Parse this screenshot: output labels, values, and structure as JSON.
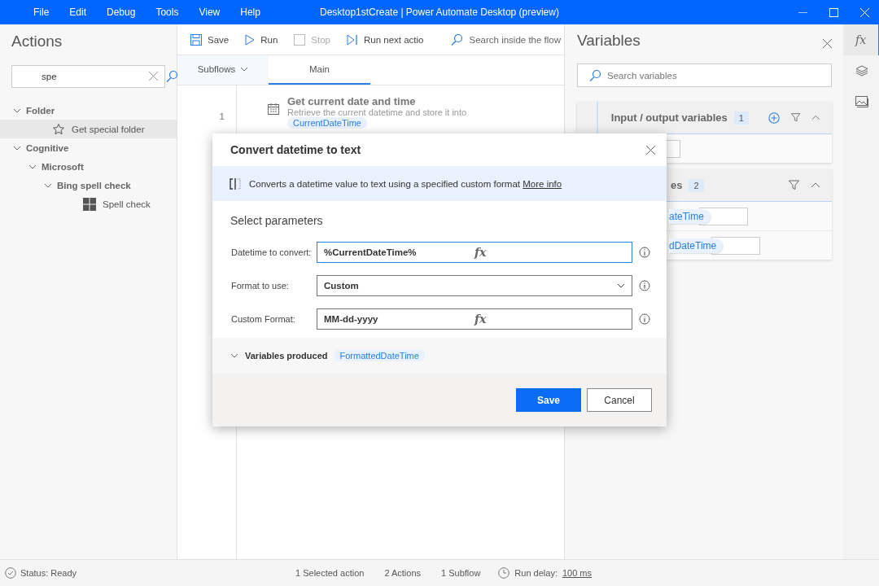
{
  "window": {
    "menu": [
      "File",
      "Edit",
      "Debug",
      "Tools",
      "View",
      "Help"
    ],
    "title": "Desktop1stCreate | Power Automate Desktop (preview)"
  },
  "actions": {
    "title": "Actions",
    "search": {
      "value": "spe"
    },
    "tree": [
      {
        "label": "Folder",
        "expanded": true,
        "children": [
          {
            "label": "Get special folder",
            "selected": true
          }
        ]
      },
      {
        "label": "Cognitive",
        "expanded": true,
        "children": [
          {
            "label": "Microsoft",
            "expanded": true,
            "children": [
              {
                "label": "Bing spell check",
                "expanded": true,
                "children": [
                  {
                    "label": "Spell check",
                    "selected": false
                  }
                ]
              }
            ]
          }
        ]
      }
    ]
  },
  "toolbar": {
    "buttons": [
      {
        "label": "Save",
        "disabled": false
      },
      {
        "label": "Run",
        "disabled": false
      },
      {
        "label": "Stop",
        "disabled": true
      },
      {
        "label": "Run next actio",
        "disabled": false
      }
    ],
    "search": {
      "placeholder": "Search inside the flow"
    }
  },
  "tabs": [
    {
      "label": "Subflows",
      "kind": "dropdown",
      "selected": false
    },
    {
      "label": "Main",
      "kind": "tab",
      "selected": true
    }
  ],
  "steps": [
    {
      "number": "1",
      "title": "Get current date and time",
      "description": "Retrieve the current datetime and store it into",
      "variable": "CurrentDateTime"
    }
  ],
  "variables": {
    "title": "Variables",
    "search": {
      "placeholder": "Search variables"
    },
    "sections": [
      {
        "title": "Input / output variables",
        "count": "1",
        "expanded": true,
        "rows": [
          ""
        ]
      },
      {
        "title": "es",
        "count": "2",
        "expanded": true,
        "rows": [
          "ateTime",
          "dDateTime"
        ]
      }
    ]
  },
  "dialog": {
    "title": "Convert datetime to text",
    "info": "Converts a datetime value to text using a specified custom format",
    "link": "More info",
    "heading": "Select parameters",
    "params": [
      {
        "label": "Datetime to convert:",
        "value": "%CurrentDateTime%",
        "kind": "expression",
        "focused": true,
        "button": "fx"
      },
      {
        "label": "Format to use:",
        "value": "Custom",
        "kind": "dropdown",
        "focused": false
      },
      {
        "label": "Custom Format:",
        "value": "MM-dd-yyyy",
        "kind": "expression",
        "focused": false,
        "button": "fx"
      }
    ],
    "produced": {
      "label": "Variables produced",
      "expanded": true,
      "variables": [
        "FormattedDateTime"
      ]
    },
    "buttons": [
      {
        "label": "Save",
        "kind": "primary"
      },
      {
        "label": "Cancel",
        "kind": "secondary"
      }
    ]
  },
  "side_rail": {
    "variables_button": "fx"
  },
  "status_bar": {
    "status": "Status: Ready",
    "counts": [
      "1 Selected action",
      "2 Actions",
      "1 Subflow"
    ],
    "run_delay_label": "Run delay:",
    "run_delay": "100 ms"
  }
}
